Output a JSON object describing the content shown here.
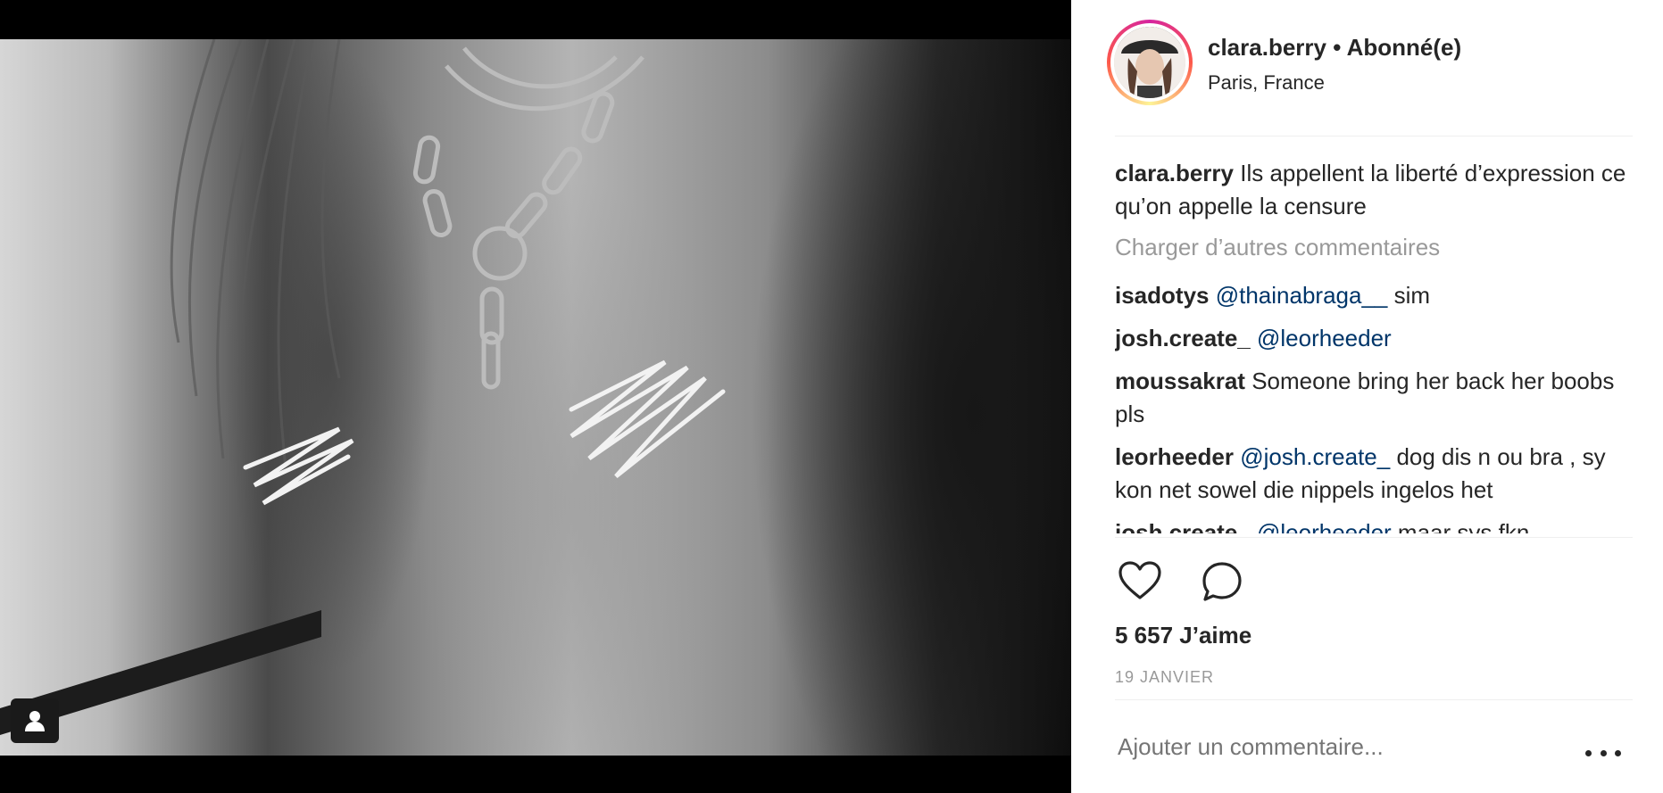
{
  "post": {
    "author": {
      "username": "clara.berry",
      "separator": " • ",
      "follow_status": "Abonné(e)",
      "location": "Paris, France",
      "avatar_icon": "profile-photo"
    },
    "caption": {
      "username": "clara.berry",
      "text": "Ils appellent la liberté d’expression ce qu’on appelle la censure"
    },
    "load_more_label": "Charger d’autres commentaires",
    "comments": [
      {
        "username": "isadotys",
        "mention": "@thainabraga__",
        "text": " sim"
      },
      {
        "username": "josh.create_",
        "mention": "@leorheeder",
        "text": ""
      },
      {
        "username": "moussakrat",
        "mention": "",
        "text": "Someone bring her back her boobs pls"
      },
      {
        "username": "leorheeder",
        "mention": "@josh.create_",
        "text": " dog dis n ou bra , sy kon net sowel die nippels ingelos het"
      },
      {
        "username": "josh.create_",
        "mention": "@leorheeder",
        "text": " maar sys fkn"
      }
    ],
    "actions": {
      "like_icon": "heart-icon",
      "comment_icon": "comment-bubble-icon"
    },
    "likes_label": "5 657 J’aime",
    "date": "19 JANVIER",
    "comment_input": {
      "placeholder": "Ajouter un commentaire..."
    },
    "more_icon": "more-options-icon",
    "media": {
      "tag_icon": "user-tag-icon"
    }
  }
}
